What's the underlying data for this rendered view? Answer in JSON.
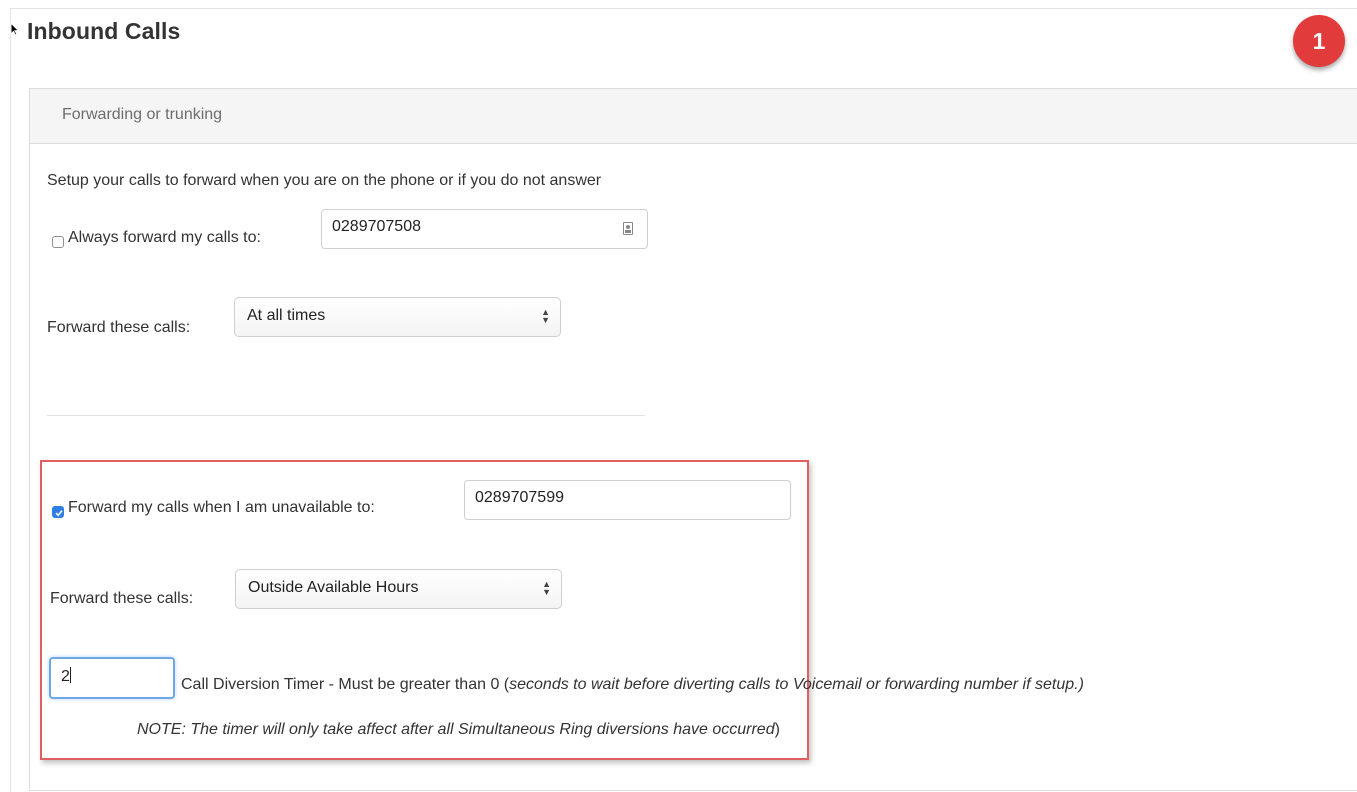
{
  "header": {
    "title": "Inbound Calls",
    "step_badge": "1"
  },
  "panel": {
    "heading": "Forwarding or trunking",
    "intro": "Setup your calls to forward when you are on the phone or if you do not answer"
  },
  "always_forward": {
    "checked": false,
    "label": "Always forward my calls to:",
    "number": "0289707508",
    "when_label": "Forward these calls:",
    "when_value": "At all times"
  },
  "unavailable_forward": {
    "checked": true,
    "label": "Forward my calls when I am unavailable to:",
    "number": "0289707599",
    "when_label": "Forward these calls:",
    "when_value": "Outside Available Hours"
  },
  "diversion_timer": {
    "value": "2",
    "label": "Call Diversion Timer - Must be greater than 0 (",
    "hint": "seconds to wait before diverting calls to Voicemail or forwarding number if setup.)",
    "note": "NOTE: The timer will only take affect after all Simultaneous Ring diversions have occurred",
    "note_close": ")"
  },
  "colors": {
    "badge": "#e23b3b",
    "highlight_border": "#e06060",
    "checkbox_checked": "#2f7ee3",
    "focus_ring": "#6ea7e8"
  }
}
